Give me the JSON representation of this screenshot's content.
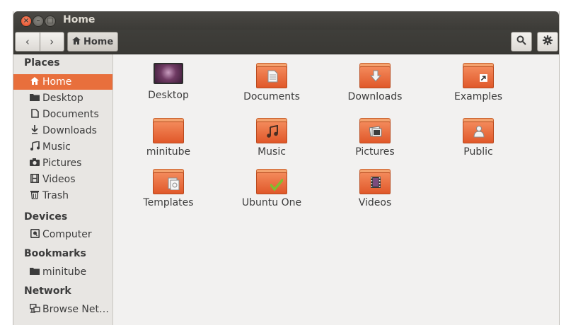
{
  "window": {
    "title": "Home"
  },
  "titlebar": {
    "close_glyph": "×",
    "min_glyph": "–",
    "max_glyph": "□"
  },
  "toolbar": {
    "back_icon": "‹",
    "forward_icon": "›",
    "breadcrumb": {
      "icon": "home-icon",
      "label": "Home"
    },
    "search_icon": "search-icon",
    "gear_icon": "gear-icon"
  },
  "sidebar": {
    "sections": [
      {
        "title": "Places",
        "items": [
          {
            "label": "Home",
            "icon": "home-icon",
            "active": true
          },
          {
            "label": "Desktop",
            "icon": "folder-icon"
          },
          {
            "label": "Documents",
            "icon": "document-icon"
          },
          {
            "label": "Downloads",
            "icon": "download-icon"
          },
          {
            "label": "Music",
            "icon": "music-icon"
          },
          {
            "label": "Pictures",
            "icon": "camera-icon"
          },
          {
            "label": "Videos",
            "icon": "film-icon"
          },
          {
            "label": "Trash",
            "icon": "trash-icon"
          }
        ]
      },
      {
        "title": "Devices",
        "items": [
          {
            "label": "Computer",
            "icon": "drive-icon"
          }
        ]
      },
      {
        "title": "Bookmarks",
        "items": [
          {
            "label": "minitube",
            "icon": "folder-icon"
          }
        ]
      },
      {
        "title": "Network",
        "items": [
          {
            "label": "Browse Net…",
            "icon": "network-icon"
          }
        ]
      }
    ]
  },
  "files": [
    {
      "label": "Desktop",
      "icon": "desktop-folder-icon"
    },
    {
      "label": "Documents",
      "icon": "documents-folder-icon"
    },
    {
      "label": "Downloads",
      "icon": "downloads-folder-icon"
    },
    {
      "label": "Examples",
      "icon": "examples-folder-icon"
    },
    {
      "label": "minitube",
      "icon": "folder-icon"
    },
    {
      "label": "Music",
      "icon": "music-folder-icon"
    },
    {
      "label": "Pictures",
      "icon": "pictures-folder-icon"
    },
    {
      "label": "Public",
      "icon": "public-folder-icon"
    },
    {
      "label": "Templates",
      "icon": "templates-folder-icon"
    },
    {
      "label": "Ubuntu One",
      "icon": "ubuntu-one-folder-icon"
    },
    {
      "label": "Videos",
      "icon": "videos-folder-icon"
    }
  ],
  "colors": {
    "accent": "#e86f3c",
    "titlebar": "#3c3b37",
    "folder": "#e86f3c"
  }
}
